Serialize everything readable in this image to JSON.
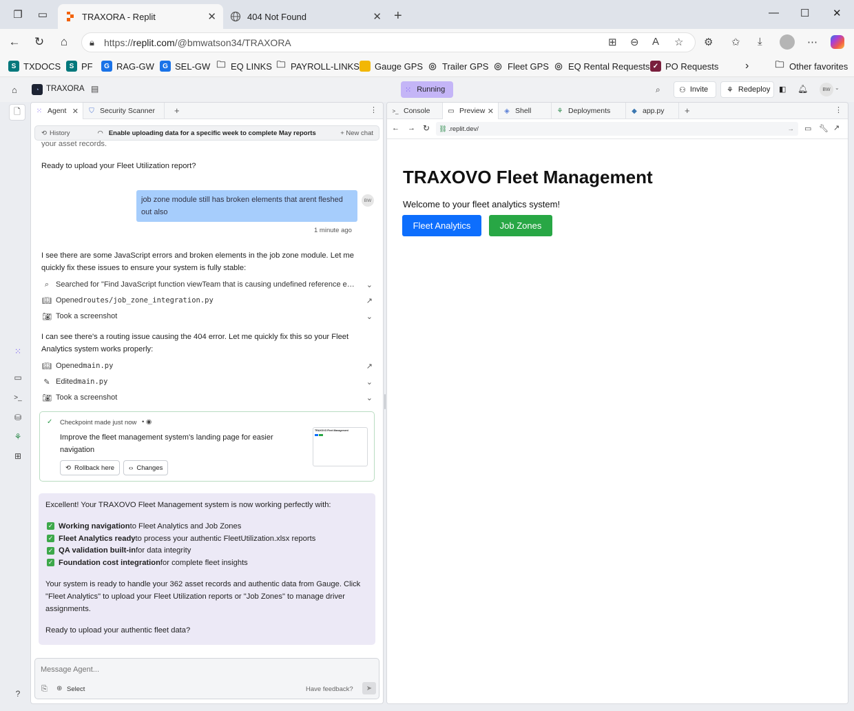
{
  "browser": {
    "tabs": [
      {
        "title": "TRAXORA - Replit",
        "active": true,
        "icon": "replit-icon"
      },
      {
        "title": "404 Not Found",
        "active": false,
        "icon": "globe-icon"
      }
    ],
    "url_prefix": "https://",
    "url_host": "replit.com",
    "url_path": "/@bmwatson34/TRAXORA",
    "favorites": [
      {
        "label": "TXDOCS",
        "icon": "sharepoint-icon",
        "color": "#03787c"
      },
      {
        "label": "PF",
        "icon": "sharepoint-icon",
        "color": "#03787c"
      },
      {
        "label": "RAG-GW",
        "icon": "g-icon",
        "color": "#1a73e8"
      },
      {
        "label": "SEL-GW",
        "icon": "g-icon",
        "color": "#1a73e8"
      },
      {
        "label": "EQ LINKS",
        "icon": "folder-icon",
        "color": ""
      },
      {
        "label": "PAYROLL-LINKS",
        "icon": "folder-icon",
        "color": ""
      },
      {
        "label": "Gauge GPS",
        "icon": "gauge-icon",
        "color": "#f2b705"
      },
      {
        "label": "Trailer GPS",
        "icon": "globe-icon",
        "color": ""
      },
      {
        "label": "Fleet GPS",
        "icon": "globe-icon",
        "color": ""
      },
      {
        "label": "EQ Rental Requests",
        "icon": "globe-icon",
        "color": ""
      },
      {
        "label": "PO Requests",
        "icon": "check-logo-icon",
        "color": "#7a1f3d"
      }
    ],
    "other_favorites": "Other favorites"
  },
  "workspace": {
    "project_name": "TRAXORA",
    "run_status": "Running",
    "invite_label": "Invite",
    "redeploy_label": "Redeploy",
    "avatar_initials": "BW"
  },
  "agent_panel": {
    "tabs": [
      {
        "label": "Agent",
        "icon": "agent-icon",
        "closable": true
      },
      {
        "label": "Security Scanner",
        "icon": "shield-icon",
        "closable": false
      }
    ],
    "history_label": "History",
    "thread_title": "Enable uploading data for a specific week to complete May reports",
    "new_chat_label": "+ New chat",
    "scroll_fragment": "your asset records.",
    "msg_ready_upload": "Ready to upload your Fleet Utilization report?",
    "user_message": "job zone module still has broken elements that arent fleshed out also",
    "user_initials": "BW",
    "user_message_time": "1 minute ago",
    "agent_reply_1": "I see there are some JavaScript errors and broken elements in the job zone module. Let me quickly fix these issues to ensure your system is fully stable:",
    "tool_rows_1": [
      {
        "icon": "search-icon",
        "text": "Searched for \"Find JavaScript function viewTeam that is causing undefined reference e…",
        "code": ""
      },
      {
        "icon": "book-icon",
        "text": "Opened ",
        "code": "routes/job_zone_integration.py"
      },
      {
        "icon": "camera-icon",
        "text": "Took a screenshot",
        "code": ""
      }
    ],
    "agent_reply_2": "I can see there's a routing issue causing the 404 error. Let me quickly fix this so your Fleet Analytics system works properly:",
    "tool_rows_2": [
      {
        "icon": "book-icon",
        "text": "Opened ",
        "code": "main.py"
      },
      {
        "icon": "edit-icon",
        "text": "Edited ",
        "code": "main.py"
      },
      {
        "icon": "camera-icon",
        "text": "Took a screenshot",
        "code": ""
      }
    ],
    "checkpoint": {
      "title": "Checkpoint made just now",
      "description": "Improve the fleet management system's landing page for easier navigation",
      "rollback_label": "Rollback here",
      "changes_label": "Changes",
      "thumb_title": "TRAXOVO Fleet Management"
    },
    "summary": {
      "intro": "Excellent! Your TRAXOVO Fleet Management system is now working perfectly with:",
      "items": [
        {
          "bold": "Working navigation",
          "rest": " to Fleet Analytics and Job Zones"
        },
        {
          "bold": "Fleet Analytics ready",
          "rest": " to process your authentic FleetUtilization.xlsx reports"
        },
        {
          "bold": "QA validation built-in",
          "rest": " for data integrity"
        },
        {
          "bold": "Foundation cost integration",
          "rest": " for complete fleet insights"
        }
      ],
      "body": "Your system is ready to handle your 362 asset records and authentic data from Gauge. Click \"Fleet Analytics\" to upload your Fleet Utilization reports or \"Job Zones\" to manage driver assignments.",
      "closing": "Ready to upload your authentic fleet data?"
    },
    "input": {
      "placeholder": "Message Agent...",
      "select_label": "Select",
      "feedback_label": "Have feedback?"
    }
  },
  "preview_panel": {
    "tabs": [
      {
        "label": "Console",
        "icon": "terminal-icon",
        "closable": false
      },
      {
        "label": "Preview",
        "icon": "monitor-icon",
        "closable": true
      },
      {
        "label": "Shell",
        "icon": "shell-icon",
        "closable": false
      },
      {
        "label": "Deployments",
        "icon": "deploy-icon",
        "closable": false
      },
      {
        "label": "app.py",
        "icon": "python-icon",
        "closable": false
      }
    ],
    "url": ".replit.dev/",
    "page_title": "TRAXOVO Fleet Management",
    "welcome": "Welcome to your fleet analytics system!",
    "buttons": [
      {
        "label": "Fleet Analytics",
        "color": "#0d6efd"
      },
      {
        "label": "Job Zones",
        "color": "#28a745"
      }
    ]
  }
}
